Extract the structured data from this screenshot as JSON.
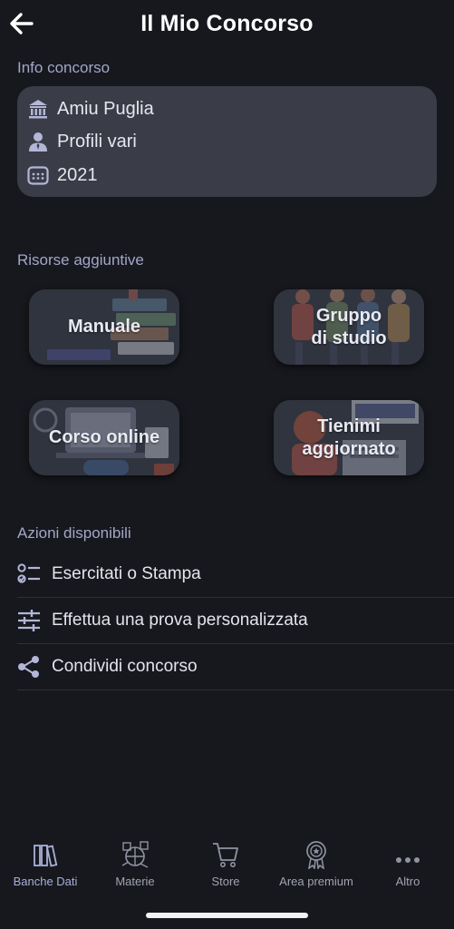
{
  "header": {
    "title": "Il Mio Concorso",
    "back_icon": "arrow-left-icon"
  },
  "info": {
    "section_label": "Info concorso",
    "rows": [
      {
        "icon": "institution-icon",
        "text": "Amiu Puglia"
      },
      {
        "icon": "person-icon",
        "text": "Profili vari"
      },
      {
        "icon": "calendar-icon",
        "text": "2021"
      }
    ]
  },
  "resources": {
    "section_label": "Risorse aggiuntive",
    "cards": [
      {
        "label": "Manuale"
      },
      {
        "label": "Gruppo\ndi studio"
      },
      {
        "label": "Corso online"
      },
      {
        "label": "Tienimi\naggiornato"
      }
    ]
  },
  "actions": {
    "section_label": "Azioni disponibili",
    "items": [
      {
        "icon": "checklist-icon",
        "label": "Esercitati o Stampa"
      },
      {
        "icon": "sliders-icon",
        "label": "Effettua una prova personalizzata"
      },
      {
        "icon": "share-icon",
        "label": "Condividi concorso"
      }
    ]
  },
  "tabbar": {
    "active": "Banche Dati",
    "tabs": [
      {
        "icon": "books-icon",
        "label": "Banche Dati"
      },
      {
        "icon": "subjects-icon",
        "label": "Materie"
      },
      {
        "icon": "cart-icon",
        "label": "Store"
      },
      {
        "icon": "medal-icon",
        "label": "Area premium"
      },
      {
        "icon": "more-icon",
        "label": "Altro"
      }
    ]
  },
  "colors": {
    "background": "#16181d",
    "card": "#3a3c48",
    "accent": "#a9b0da",
    "section_label": "#a3a6c8"
  }
}
